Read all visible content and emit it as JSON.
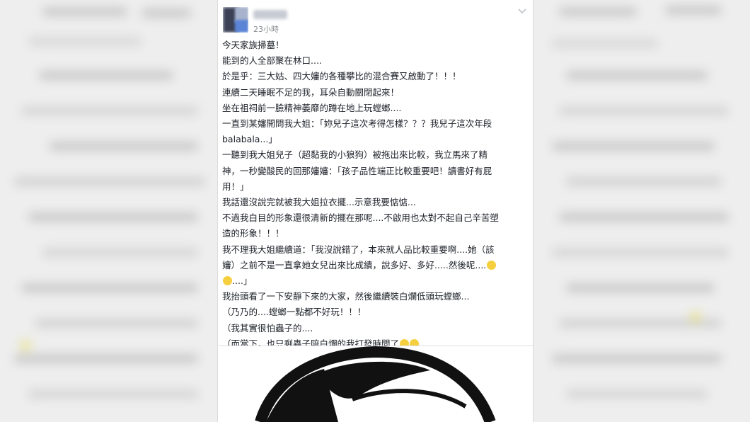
{
  "post": {
    "timestamp": "23小時",
    "lines": [
      "今天家族掃墓！",
      "能到的人全部聚在林口....",
      "於是乎：三大姑、四大嬸的各種攀比的混合賽又啟動了！！！",
      "連續二天睡眠不足的我，耳朵自動關閉起來！",
      "坐在祖祠前一臉精神萎靡的蹲在地上玩螳螂....",
      "一直到某嬸開問我大姐：「妳兒子這次考得怎樣？？？我兒子這次年段",
      "balabala...」",
      "一聽到我大姐兒子（超黏我的小狼狗）被拖出來比較，我立馬來了精",
      "神，一秒變酸民的回那嬸嬸：「孩子品性端正比較重要吧！讀書好有屁",
      "用！」",
      "我話還沒說完就被我大姐拉衣擺...示意我要惦惦...",
      "不過我白目的形象還很清新的擺在那呢....不啟用也太對不起自己辛苦塑",
      "造的形象！！！",
      "我不理我大姐繼續道：「我沒說錯了，本來就人品比較重要啊....她（該",
      "嬸）之前不是一直拿她女兒出來比成績，說多好、多好.....然後呢....",
      "....」",
      "我抬頭看了一下安靜下來的大家，然後繼續裝白爛低頭玩螳螂...",
      "（乃乃的....螳螂一點都不好玩！！！",
      "（我其實很怕蟲子的....",
      "（而當下，也只剩蟲子陪白爛的我打發時間了"
    ]
  },
  "colors": {
    "text": "#1d2129",
    "muted": "#8a8d91",
    "emoji": "#f6cf3e"
  },
  "icons": [
    "avatar-blurred",
    "chevron-down-icon",
    "eye-roll-emoji",
    "cartoon-girl-illustration"
  ]
}
